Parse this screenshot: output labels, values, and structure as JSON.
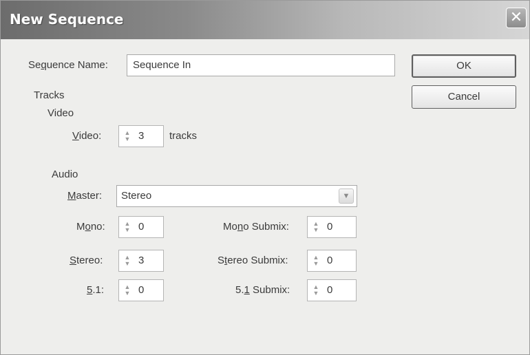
{
  "window": {
    "title": "New Sequence",
    "close_glyph": "✕"
  },
  "sequence_name": {
    "label_pre": "Se",
    "label_key": "q",
    "label_post": "uence Name:",
    "value": "Sequence In"
  },
  "buttons": {
    "ok": "OK",
    "cancel": "Cancel"
  },
  "tracks": {
    "heading": "Tracks",
    "video": {
      "heading": "Video",
      "label_key": "V",
      "label_post": "ideo:",
      "value": "3",
      "unit": "tracks"
    },
    "audio": {
      "heading": "Audio",
      "master": {
        "label_key": "M",
        "label_post": "aster:",
        "value": "Stereo"
      },
      "mono": {
        "label_pre": "M",
        "label_key": "o",
        "label_post": "no:",
        "value": "0"
      },
      "stereo": {
        "label_pre": "",
        "label_key": "S",
        "label_post": "tereo:",
        "value": "3"
      },
      "five_one": {
        "label_pre": "",
        "label_key": "5",
        "label_post": ".1:",
        "value": "0"
      },
      "mono_submix": {
        "label_pre": "Mo",
        "label_key": "n",
        "label_post": "o Submix:",
        "value": "0"
      },
      "stereo_submix": {
        "label_pre": "S",
        "label_key": "t",
        "label_post": "ereo Submix:",
        "value": "0"
      },
      "five_one_submix": {
        "label_pre": "5.",
        "label_key": "1",
        "label_post": " Submix:",
        "value": "0"
      }
    }
  },
  "icons": {
    "spinner": "spinner-updown-icon",
    "dropdown": "chevron-down-icon"
  }
}
